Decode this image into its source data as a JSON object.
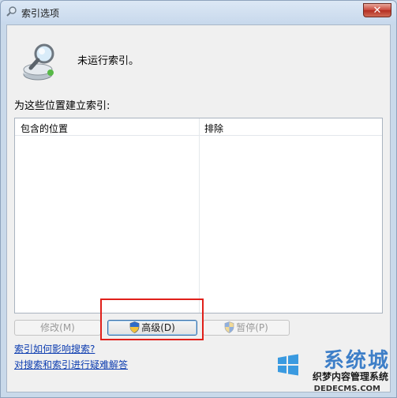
{
  "window": {
    "title": "索引选项",
    "close_label": "✕"
  },
  "status": {
    "text": "未运行索引。"
  },
  "locations": {
    "heading": "为这些位置建立索引:",
    "columns": [
      "包含的位置",
      "排除"
    ]
  },
  "buttons": {
    "modify": "修改(M)",
    "advanced": "高级(D)",
    "pause": "暂停(P)"
  },
  "links": {
    "affect_search": "索引如何影响搜索?",
    "troubleshoot": "对搜索和索引进行疑难解答"
  },
  "watermark": {
    "brand": "系统城",
    "line1": "织梦内容管理系统",
    "line2": "DEDECMS.COM"
  }
}
